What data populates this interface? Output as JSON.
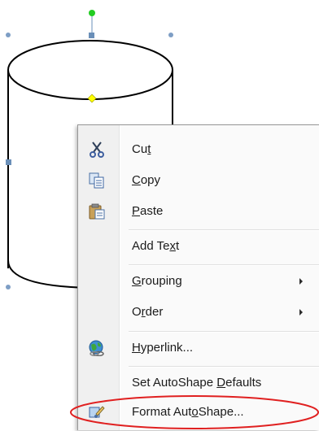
{
  "canvas": {
    "shape": "can-autoshape",
    "selection_handle_color": "#3a6ea5",
    "rotation_handle_color": "#22cc22",
    "adjust_handle_color": "#ffff00"
  },
  "context_menu": {
    "items": [
      {
        "id": "cut",
        "before": "Cu",
        "access": "t",
        "after": "",
        "icon": "scissors-icon"
      },
      {
        "id": "copy",
        "before": "",
        "access": "C",
        "after": "opy",
        "icon": "copy-icon"
      },
      {
        "id": "paste",
        "before": "",
        "access": "P",
        "after": "aste",
        "icon": "paste-icon"
      },
      {
        "id": "add-text",
        "before": "Add Te",
        "access": "x",
        "after": "t",
        "icon": ""
      },
      {
        "id": "grouping",
        "before": "",
        "access": "G",
        "after": "rouping",
        "icon": "",
        "submenu": true
      },
      {
        "id": "order",
        "before": "O",
        "access": "r",
        "after": "der",
        "icon": "",
        "submenu": true
      },
      {
        "id": "hyperlink",
        "before": "",
        "access": "H",
        "after": "yperlink...",
        "icon": "hyperlink-globe-icon"
      },
      {
        "id": "set-defaults",
        "before": "Set AutoShape ",
        "access": "D",
        "after": "efaults",
        "icon": ""
      },
      {
        "id": "format-autoshape",
        "before": "Format Aut",
        "access": "o",
        "after": "Shape...",
        "icon": "format-autoshape-icon"
      }
    ]
  },
  "annotation": {
    "highlight_color": "#e02020",
    "highlighted_item": "format-autoshape"
  }
}
